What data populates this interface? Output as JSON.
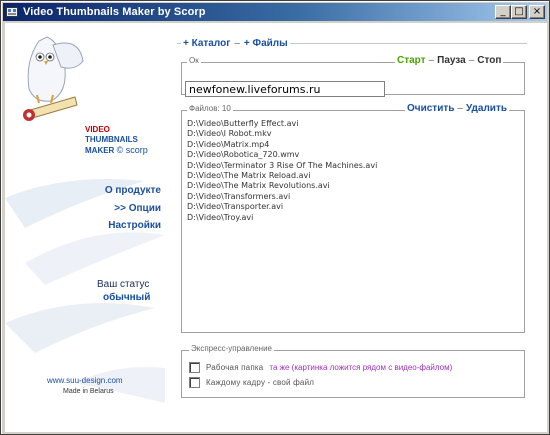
{
  "window": {
    "title": "Video Thumbnails Maker by Scorp",
    "minimize_label": "_",
    "maximize_label": "□",
    "close_label": "×"
  },
  "sidebar": {
    "logo": {
      "line1": "VIDEO",
      "line2": "THUMBNAILS",
      "line3": "MAKER",
      "by": "© scorp"
    },
    "nav": [
      {
        "label": "О продукте"
      },
      {
        "label": ">> Опции"
      },
      {
        "label": "Настройки"
      }
    ],
    "status_label": "Ваш статус",
    "status_value": "обычный",
    "site_link": "www.suu-design.com",
    "made_in": "Made in Belarus"
  },
  "header": {
    "catalog_link": "+ Каталог",
    "separator": "–",
    "files_link": "+ Файлы"
  },
  "control": {
    "legend": "Ок",
    "start": "Старт",
    "pause": "Пауза",
    "stop": "Стоп",
    "separator": "–",
    "field_value": "newfonew.liveforums.ru"
  },
  "files": {
    "legend": "Файлов: 10",
    "clear": "Очистить",
    "delete": "Удалить",
    "separator": "–",
    "items": [
      "D:\\Video\\Butterfly Effect.avi",
      "D:\\Video\\I Robot.mkv",
      "D:\\Video\\Matrix.mp4",
      "D:\\Video\\Robotica_720.wmv",
      "D:\\Video\\Terminator 3 Rise Of The Machines.avi",
      "D:\\Video\\The Matrix Reload.avi",
      "D:\\Video\\The Matrix Revolutions.avi",
      "D:\\Video\\Transformers.avi",
      "D:\\Video\\Transporter.avi",
      "D:\\Video\\Troy.avi"
    ]
  },
  "express": {
    "legend": "Экспресс-управление",
    "option1_label": "Рабочая папка",
    "option1_note": "та же (картинка ложится рядом с видео-файлом)",
    "option2_label": "Каждому кадру - свой файл"
  }
}
